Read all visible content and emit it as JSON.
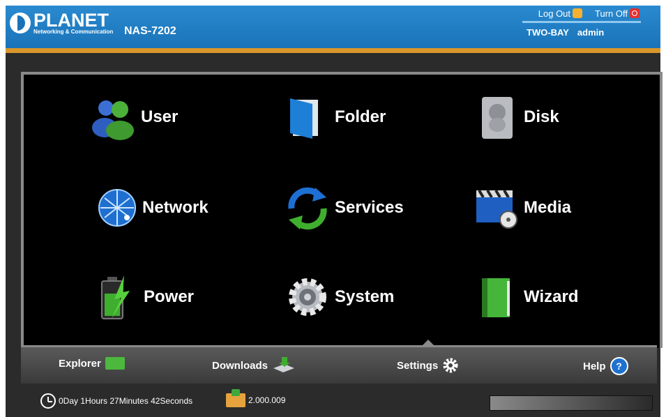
{
  "header": {
    "brand": "PLANET",
    "tagline": "Networking & Communication",
    "model": "NAS-7202",
    "logout_label": "Log Out",
    "turnoff_label": "Turn Off",
    "hostname": "TWO-BAY",
    "user": "admin"
  },
  "menu": {
    "user": "User",
    "folder": "Folder",
    "disk": "Disk",
    "network": "Network",
    "services": "Services",
    "media": "Media",
    "power": "Power",
    "system": "System",
    "wizard": "Wizard"
  },
  "bottombar": {
    "explorer": "Explorer",
    "downloads": "Downloads",
    "settings": "Settings",
    "help": "Help",
    "active": "settings"
  },
  "status": {
    "uptime": "0Day 1Hours 27Minutes 42Seconds",
    "version": "2.000.009"
  },
  "colors": {
    "header_blue": "#1a73b8",
    "accent_orange": "#d9962b",
    "panel_bg": "#000000"
  }
}
